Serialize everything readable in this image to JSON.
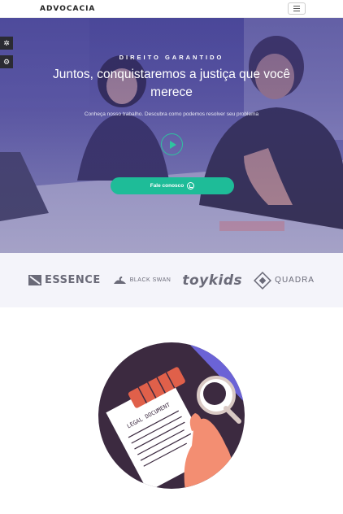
{
  "navbar": {
    "brand": "ADVOCACIA",
    "menu_icon": "hamburger-menu-icon"
  },
  "side_widgets": [
    {
      "icon": "sun-icon",
      "glyph": "✲"
    },
    {
      "icon": "gear-icon",
      "glyph": "⚙"
    }
  ],
  "hero": {
    "kicker": "DIREITO GARANTIDO",
    "title": "Juntos, conquistaremos a justiça que você merece",
    "subtitle": "Conheça nosso trabalho. Descubra como podemos resolver seu problema",
    "play_icon": "play-icon",
    "cta_label": "Fale conosco",
    "cta_icon": "whatsapp-icon",
    "accent_color": "#1ebc98"
  },
  "logos": [
    {
      "name": "ESSENCE",
      "icon": "essence-logo-icon"
    },
    {
      "name": "BLACK SWAN",
      "icon": "swan-logo-icon"
    },
    {
      "name": "toykids",
      "icon": ""
    },
    {
      "name": "QUADRA",
      "icon": "quadra-logo-icon"
    }
  ],
  "illustration": {
    "document_label": "LEGAL DOCUMENT"
  }
}
